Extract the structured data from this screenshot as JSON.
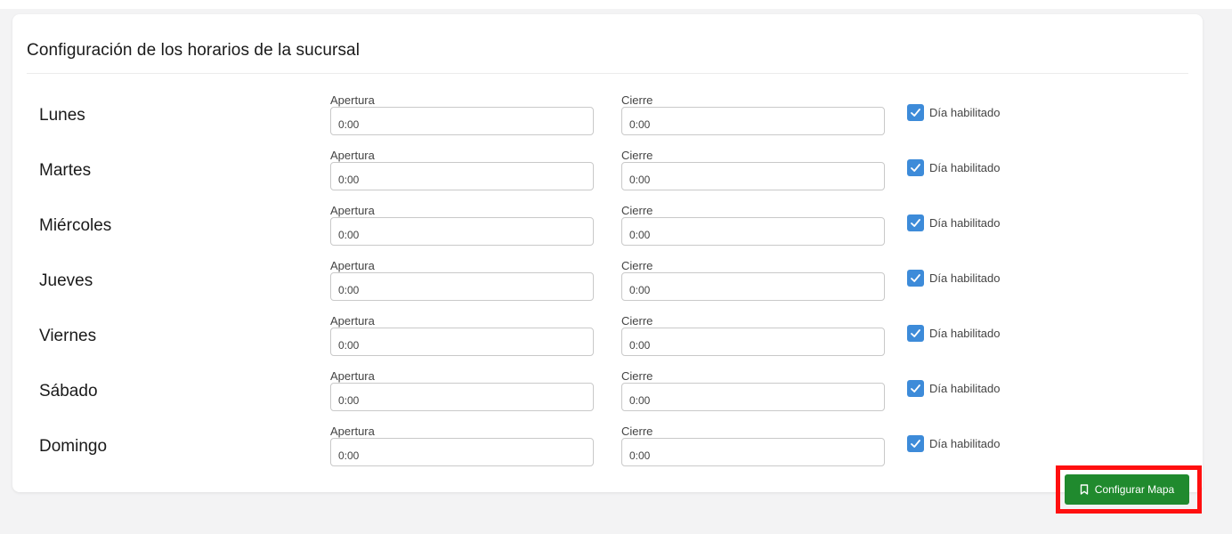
{
  "title": "Configuración de los horarios de la sucursal",
  "open_label": "Apertura",
  "close_label": "Cierre",
  "enabled_label": "Día habilitado",
  "days": [
    {
      "name": "Lunes",
      "open": "0:00",
      "close": "0:00",
      "enabled": true
    },
    {
      "name": "Martes",
      "open": "0:00",
      "close": "0:00",
      "enabled": true
    },
    {
      "name": "Miércoles",
      "open": "0:00",
      "close": "0:00",
      "enabled": true
    },
    {
      "name": "Jueves",
      "open": "0:00",
      "close": "0:00",
      "enabled": true
    },
    {
      "name": "Viernes",
      "open": "0:00",
      "close": "0:00",
      "enabled": true
    },
    {
      "name": "Sábado",
      "open": "0:00",
      "close": "0:00",
      "enabled": true
    },
    {
      "name": "Domingo",
      "open": "0:00",
      "close": "0:00",
      "enabled": true
    }
  ],
  "map_button": {
    "label": "Configurar Mapa",
    "icon": "bookmark-icon"
  },
  "colors": {
    "accent": "#3d8bd9",
    "button": "#208a2e",
    "highlight": "#ff0f0f"
  }
}
